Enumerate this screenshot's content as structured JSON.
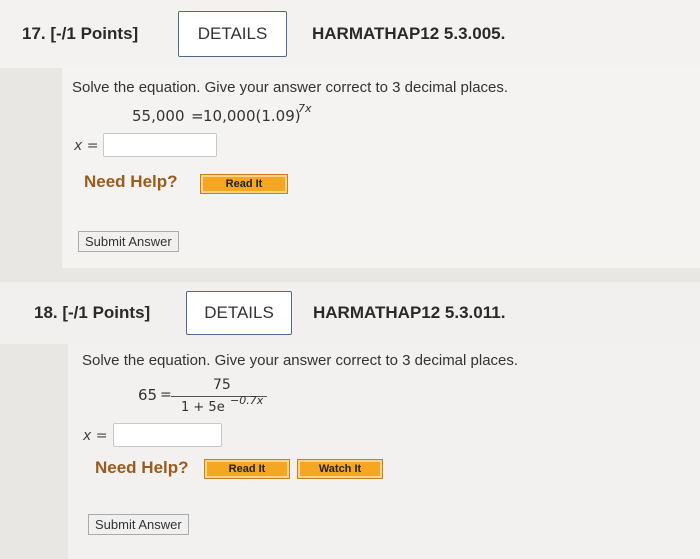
{
  "q17": {
    "number": "17. [-/1 Points]",
    "details": "DETAILS",
    "code": "HARMATHAP12 5.3.005.",
    "prompt": "Solve the equation. Give your answer correct to 3 decimal places.",
    "equation_lhs": "55,000",
    "equation_eq": "=",
    "equation_rhs": "10,000(1.09)",
    "exponent": "7x",
    "answer_label": "x =",
    "answer_value": "",
    "need_help": "Need Help?",
    "read_it": "Read It",
    "submit": "Submit Answer"
  },
  "q18": {
    "number": "18. [-/1 Points]",
    "details": "DETAILS",
    "code": "HARMATHAP12 5.3.011.",
    "prompt": "Solve the equation. Give your answer correct to 3 decimal places.",
    "lhs": "65",
    "eq_sign": "=",
    "numerator": "75",
    "denominator": "1 + 5e",
    "den_exponent": "−0.7x",
    "answer_label": "x =",
    "answer_value": "",
    "need_help": "Need Help?",
    "read_it": "Read It",
    "watch_it": "Watch It",
    "submit": "Submit Answer"
  }
}
